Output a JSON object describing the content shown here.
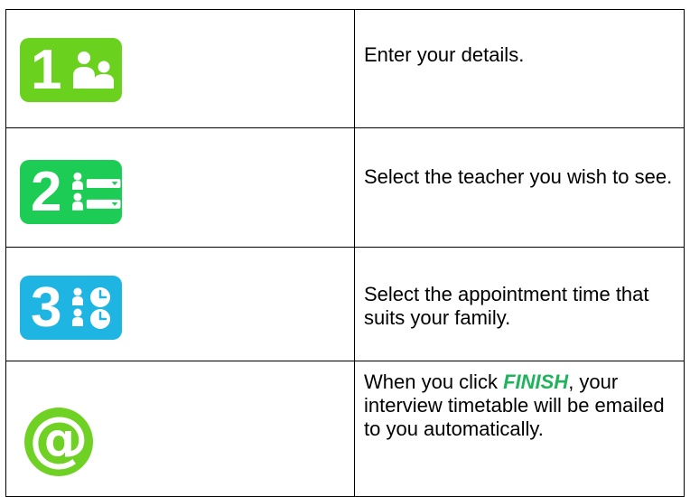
{
  "colors": {
    "step1": "#6ad11e",
    "step2": "#1ccc55",
    "step3": "#1fb5e3",
    "email": "#6fd123",
    "finish": "#1fb35b"
  },
  "steps": [
    {
      "number": "1",
      "icon": "people-icon",
      "text": "Enter your details."
    },
    {
      "number": "2",
      "icon": "teacher-list-icon",
      "text": "Select the teacher you wish to see."
    },
    {
      "number": "3",
      "icon": "appointment-clock-icon",
      "text": "Select the appointment time that suits your family."
    }
  ],
  "final_step": {
    "icon": "email-at-icon",
    "symbol": "@",
    "text_before": "When you click ",
    "finish_word": "FINISH",
    "text_after": ", your interview timetable will be emailed to you automatically."
  }
}
